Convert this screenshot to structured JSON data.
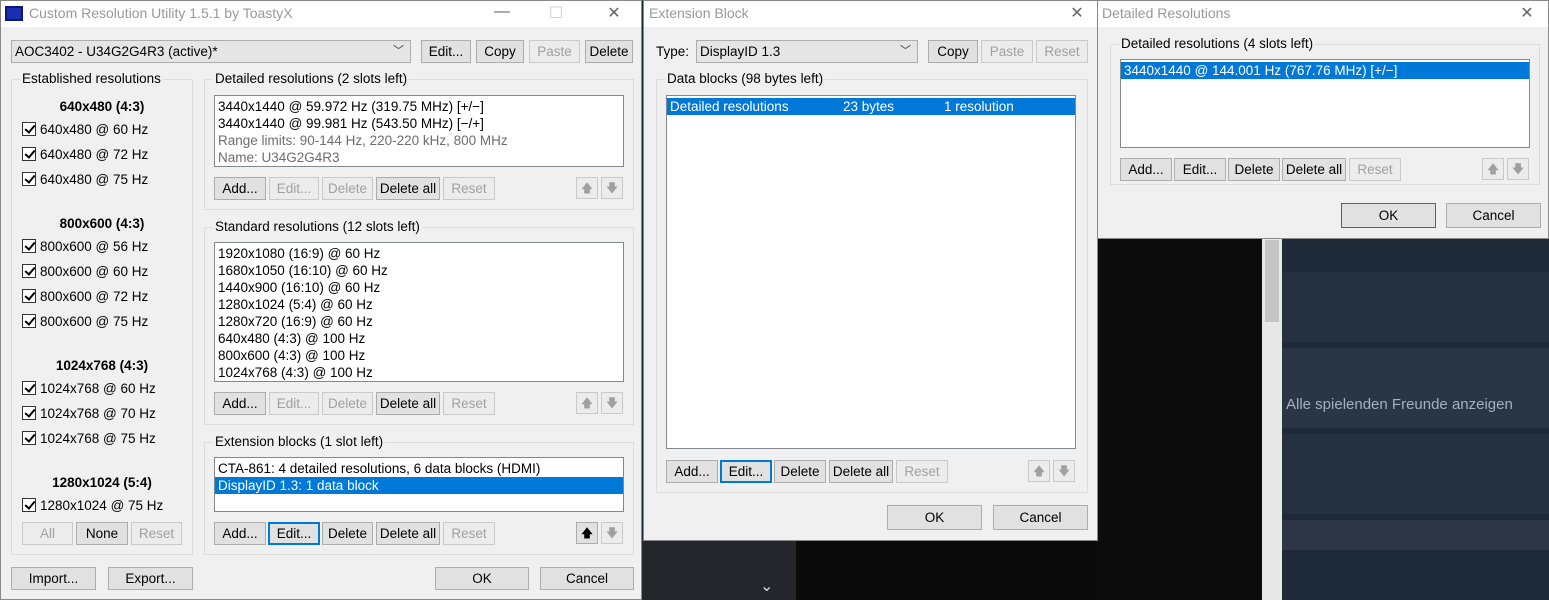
{
  "background": {
    "steam_text": "Alle spielenden Freunde anzeigen",
    "chevron": "⌄"
  },
  "cru": {
    "title": "Custom Resolution Utility 1.5.1 by ToastyX",
    "monitor_select": "AOC3402 - U34G2G4R3 (active)*",
    "top_buttons": {
      "edit": "Edit...",
      "copy": "Copy",
      "paste": "Paste",
      "delete": "Delete"
    },
    "established": {
      "label": "Established resolutions",
      "groups": [
        {
          "header": "640x480 (4:3)",
          "items": [
            "640x480 @ 60 Hz",
            "640x480 @ 72 Hz",
            "640x480 @ 75 Hz"
          ]
        },
        {
          "header": "800x600 (4:3)",
          "items": [
            "800x600 @ 56 Hz",
            "800x600 @ 60 Hz",
            "800x600 @ 72 Hz",
            "800x600 @ 75 Hz"
          ]
        },
        {
          "header": "1024x768 (4:3)",
          "items": [
            "1024x768 @ 60 Hz",
            "1024x768 @ 70 Hz",
            "1024x768 @ 75 Hz"
          ]
        },
        {
          "header": "1280x1024 (5:4)",
          "items": [
            "1280x1024 @ 75 Hz"
          ]
        }
      ],
      "buttons": {
        "all": "All",
        "none": "None",
        "reset": "Reset"
      }
    },
    "detailed": {
      "label": "Detailed resolutions (2 slots left)",
      "items": [
        "3440x1440 @ 59.972 Hz (319.75 MHz) [+/−]",
        "3440x1440 @ 99.981 Hz (543.50 MHz) [−/+]"
      ],
      "gray_items": [
        "Range limits: 90-144 Hz, 220-220 kHz, 800 MHz",
        "Name: U34G2G4R3"
      ]
    },
    "standard": {
      "label": "Standard resolutions (12 slots left)",
      "items": [
        "1920x1080 (16:9) @ 60 Hz",
        "1680x1050 (16:10) @ 60 Hz",
        "1440x900 (16:10) @ 60 Hz",
        "1280x1024 (5:4) @ 60 Hz",
        "1280x720 (16:9) @ 60 Hz",
        "640x480 (4:3) @ 100 Hz",
        "800x600 (4:3) @ 100 Hz",
        "1024x768 (4:3) @ 100 Hz"
      ]
    },
    "extension": {
      "label": "Extension blocks (1 slot left)",
      "items": [
        "CTA-861: 4 detailed resolutions, 6 data blocks (HDMI)",
        "DisplayID 1.3: 1 data block"
      ]
    },
    "list_buttons": {
      "add": "Add...",
      "edit": "Edit...",
      "delete": "Delete",
      "delete_all": "Delete all",
      "reset": "Reset"
    },
    "arrows": {
      "up": "🡅",
      "down": "🡇"
    },
    "bottom": {
      "import": "Import...",
      "export": "Export...",
      "ok": "OK",
      "cancel": "Cancel"
    }
  },
  "ext": {
    "title": "Extension Block",
    "type_label": "Type:",
    "type_value": "DisplayID 1.3",
    "buttons": {
      "copy": "Copy",
      "paste": "Paste",
      "reset": "Reset"
    },
    "data_blocks": {
      "label": "Data blocks (98 bytes left)",
      "row": {
        "name": "Detailed resolutions",
        "size": "23 bytes",
        "count": "1 resolution"
      }
    },
    "bottom": {
      "ok": "OK",
      "cancel": "Cancel"
    }
  },
  "det": {
    "title": "Detailed Resolutions",
    "label": "Detailed resolutions (4 slots left)",
    "items": [
      "3440x1440 @ 144.001 Hz (767.76 MHz) [+/−]"
    ],
    "bottom": {
      "ok": "OK",
      "cancel": "Cancel"
    }
  },
  "window_controls": {
    "minimize": "—",
    "maximize": "☐",
    "close": "✕"
  }
}
